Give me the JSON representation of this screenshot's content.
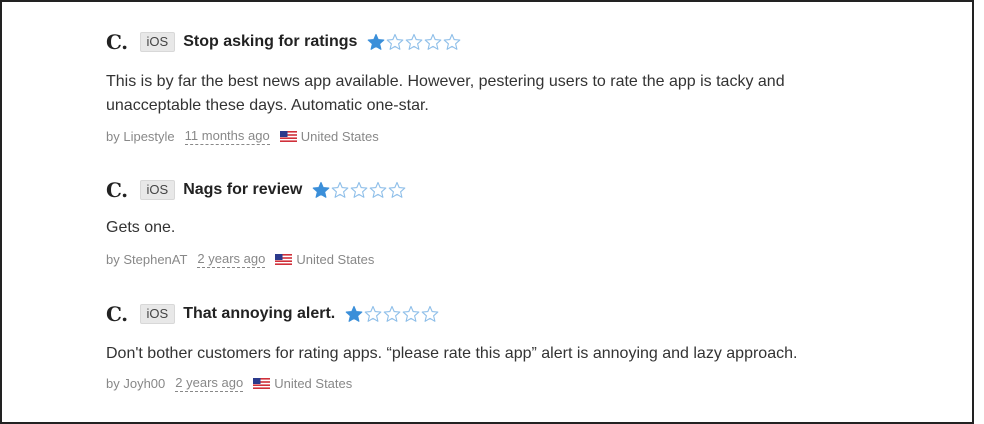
{
  "colors": {
    "star_filled": "#3b8fd9",
    "star_empty": "#8fbfe9",
    "meta_text": "#888888"
  },
  "reviews": [
    {
      "app_letter": "C.",
      "platform": "iOS",
      "title": "Stop asking for ratings",
      "rating": 1,
      "max_rating": 5,
      "body": "This is by far the best news app available. However, pestering users to rate the app is tacky and unacceptable these days. Automatic one-star.",
      "author": "by Lipestyle",
      "time": "11 months ago",
      "country_icon": "us-flag-icon",
      "country": "United States"
    },
    {
      "app_letter": "C.",
      "platform": "iOS",
      "title": "Nags for review",
      "rating": 1,
      "max_rating": 5,
      "body": "Gets one.",
      "author": "by StephenAT",
      "time": "2 years ago",
      "country_icon": "us-flag-icon",
      "country": "United States"
    },
    {
      "app_letter": "C.",
      "platform": "iOS",
      "title": "That annoying alert.",
      "rating": 1,
      "max_rating": 5,
      "body": "Don't bother customers for rating apps. “please rate this app” alert is annoying and lazy approach.",
      "author": "by Joyh00",
      "time": "2 years ago",
      "country_icon": "us-flag-icon",
      "country": "United States"
    }
  ]
}
